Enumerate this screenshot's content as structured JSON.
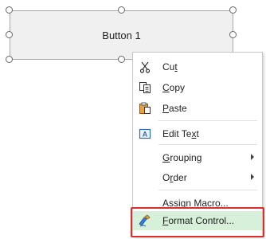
{
  "button": {
    "label": "Button 1"
  },
  "menu": {
    "items": [
      {
        "pre": "Cu",
        "key": "t",
        "post": "",
        "icon": "scissors-icon"
      },
      {
        "pre": "",
        "key": "C",
        "post": "opy",
        "icon": "copy-icon"
      },
      {
        "pre": "",
        "key": "P",
        "post": "aste",
        "icon": "paste-icon"
      },
      {
        "pre": "Edit Te",
        "key": "x",
        "post": "t",
        "icon": "edit-text-icon"
      },
      {
        "pre": "",
        "key": "G",
        "post": "rouping"
      },
      {
        "pre": "O",
        "key": "r",
        "post": "der"
      },
      {
        "pre": "Assig",
        "key": "n",
        "post": " Macro..."
      },
      {
        "pre": "",
        "key": "F",
        "post": "ormat Control...",
        "icon": "format-control-icon"
      }
    ]
  },
  "colors": {
    "highlight_border": "#d9302c",
    "hover_fill": "#d7f0d9"
  }
}
